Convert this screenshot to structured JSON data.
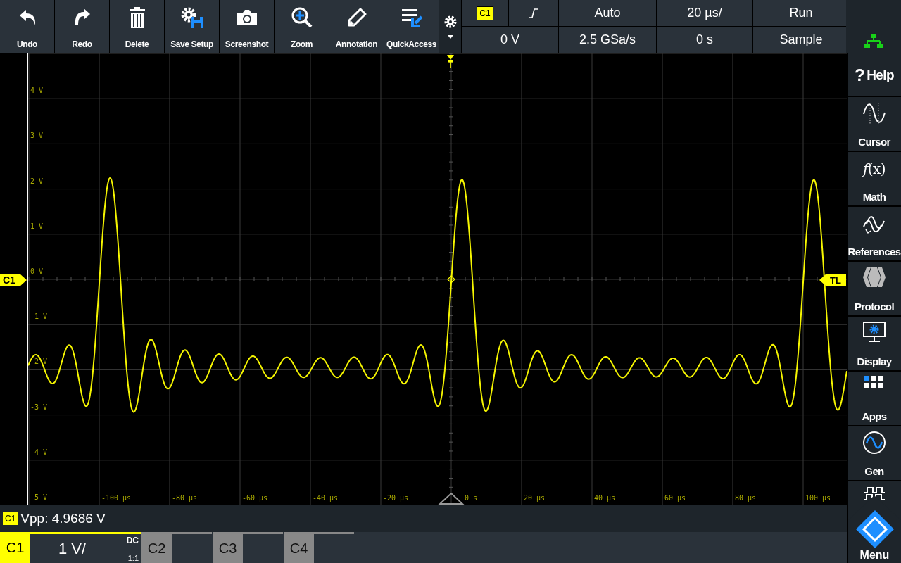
{
  "toolbar": {
    "buttons": [
      {
        "kind": "undo",
        "label": "Undo"
      },
      {
        "kind": "redo",
        "label": "Redo"
      },
      {
        "kind": "delete",
        "label": "Delete"
      },
      {
        "kind": "save",
        "label": "Save Setup"
      },
      {
        "kind": "screenshot",
        "label": "Screenshot"
      },
      {
        "kind": "zoom",
        "label": "Zoom"
      },
      {
        "kind": "annotation",
        "label": "Annotation"
      },
      {
        "kind": "quickaccess",
        "label": "QuickAccess"
      }
    ]
  },
  "trigger": {
    "source": "C1",
    "mode": "Auto",
    "timebase": "20 µs/",
    "run_state": "Run",
    "level": "0 V",
    "sample_rate": "2.5 GSa/s",
    "position": "0 s",
    "acquisition": "Sample"
  },
  "graph": {
    "y_labels": [
      "4 V",
      "3 V",
      "2 V",
      "1 V",
      "0 V",
      "-1 V",
      "-2 V",
      "-3 V",
      "-4 V",
      "-5 V"
    ],
    "x_labels": [
      "-100 µs",
      "-80 µs",
      "-60 µs",
      "-40 µs",
      "-20 µs",
      "0 s",
      "20 µs",
      "40 µs",
      "60 µs",
      "80 µs",
      "100 µs"
    ],
    "channel_marker": "C1",
    "trigger_marker": "T",
    "level_marker": "TL"
  },
  "sidebar": {
    "items": [
      {
        "kind": "help",
        "icon": "?",
        "label": "Help"
      },
      {
        "kind": "cursor",
        "label": "Cursor"
      },
      {
        "kind": "math",
        "icon": "*f*(x)",
        "label": "Math"
      },
      {
        "kind": "references",
        "label": "References"
      },
      {
        "kind": "protocol",
        "label": "Protocol"
      },
      {
        "kind": "display",
        "label": "Display"
      },
      {
        "kind": "apps",
        "label": "Apps"
      },
      {
        "kind": "gen",
        "label": "Gen"
      },
      {
        "kind": "bus"
      }
    ],
    "menu_label": "Menu"
  },
  "measurement": {
    "source": "C1",
    "text": "Vpp: 4.9686 V"
  },
  "channels": [
    {
      "label": "C1",
      "selected": true,
      "scale": "1 V/",
      "coupling": "DC",
      "probe": "1:1"
    },
    {
      "label": "C2",
      "selected": false
    },
    {
      "label": "C3",
      "selected": false
    },
    {
      "label": "C4",
      "selected": false
    }
  ]
}
